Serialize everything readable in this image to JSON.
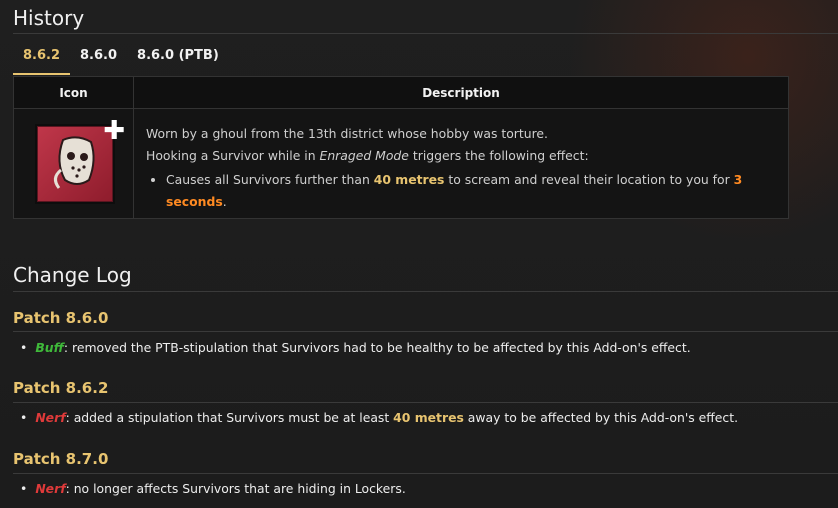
{
  "history": {
    "title": "History",
    "tabs": [
      "8.6.2",
      "8.6.0",
      "8.6.0 (PTB)"
    ],
    "table": {
      "headers": [
        "Icon",
        "Description"
      ],
      "icon_name": "hockey-mask-addon-icon",
      "line1": "Worn by a ghoul from the 13th district whose hobby was torture.",
      "line2_pre": "Hooking a Survivor while in ",
      "line2_em": "Enraged Mode",
      "line2_post": " triggers the following effect:",
      "bullet_pre": "Causes all Survivors further than ",
      "bullet_dist": "40 metres",
      "bullet_mid": " to scream and reveal their location to you for ",
      "bullet_time": "3 seconds",
      "bullet_end": "."
    }
  },
  "changelog": {
    "title": "Change Log",
    "patches": [
      {
        "name": "Patch 8.6.0",
        "tag": "Buff",
        "text": ": removed the PTB-stipulation that Survivors had to be healthy to be affected by this Add-on's effect."
      },
      {
        "name": "Patch 8.6.2",
        "tag": "Nerf",
        "pre": ": added a stipulation that Survivors must be at least ",
        "hl": "40 metres",
        "post": " away to be affected by this Add-on's effect."
      },
      {
        "name": "Patch 8.7.0",
        "tag": "Nerf",
        "text": ": no longer affects Survivors that are hiding in Lockers."
      }
    ]
  },
  "colors": {
    "accent": "#e8c470",
    "buff": "#3fb93a",
    "nerf": "#e03a3a",
    "highlight_orange": "#ff8a22"
  }
}
